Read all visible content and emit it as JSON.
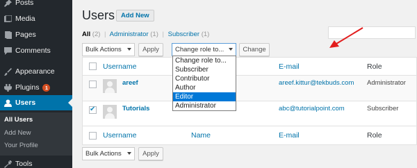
{
  "sidebar": {
    "menu": [
      {
        "label": "Posts",
        "icon": "pushpin-icon"
      },
      {
        "label": "Media",
        "icon": "media-icon"
      },
      {
        "label": "Pages",
        "icon": "page-icon"
      },
      {
        "label": "Comments",
        "icon": "comment-icon"
      },
      {
        "label": "Appearance",
        "icon": "brush-icon"
      },
      {
        "label": "Plugins",
        "icon": "plugin-icon",
        "badge": "1"
      },
      {
        "label": "Users",
        "icon": "user-icon"
      },
      {
        "label": "Tools",
        "icon": "wrench-icon"
      }
    ],
    "submenu": [
      "All Users",
      "Add New",
      "Your Profile"
    ]
  },
  "page": {
    "title": "Users",
    "add_new": "Add New"
  },
  "views": {
    "all": "All",
    "all_count": "(2)",
    "admin": "Administrator",
    "admin_count": "(1)",
    "sub": "Subscriber",
    "sub_count": "(1)",
    "sep": "|"
  },
  "bulk": {
    "top_select": "Bulk Actions",
    "apply": "Apply",
    "bottom_select": "Bulk Actions",
    "bottom_apply": "Apply"
  },
  "role_select": {
    "value": "Change role to...",
    "button": "Change",
    "options": [
      "Change role to...",
      "Subscriber",
      "Contributor",
      "Author",
      "Editor",
      "Administrator"
    ],
    "highlighted": "Editor"
  },
  "table": {
    "columns": {
      "username": "Username",
      "name": "Name",
      "email": "E-mail",
      "role": "Role"
    },
    "rows": [
      {
        "username": "areef",
        "email": "areef.kittur@tekbuds.com",
        "role": "Administrator",
        "checked": false
      },
      {
        "username": "Tutorials",
        "email": "abc@tutorialpoint.com",
        "role": "Subscriber",
        "checked": true
      }
    ]
  },
  "colors": {
    "sidebar_bg": "#23282d",
    "active_bg": "#0073aa",
    "link": "#0073aa",
    "badge": "#d54e21",
    "arrow": "#e21d1d",
    "dropdown_highlight": "#0078d7"
  }
}
